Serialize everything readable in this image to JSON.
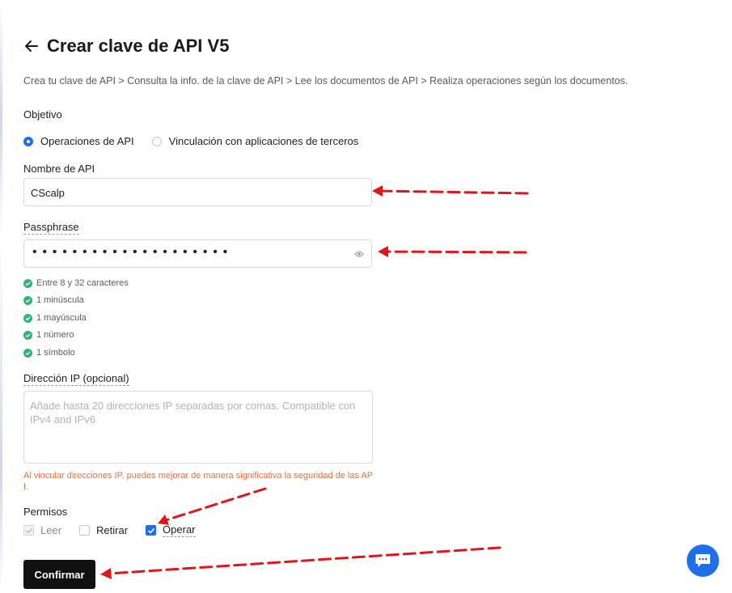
{
  "header": {
    "title": "Crear clave de API V5",
    "back_icon": "arrow-left-icon"
  },
  "breadcrumb": "Crea tu clave de API > Consulta la info. de la clave de API > Lee los documentos de API > Realiza operaciones según los documentos.",
  "objective": {
    "label": "Objetivo",
    "options": [
      {
        "label": "Operaciones de API",
        "selected": true
      },
      {
        "label": "Vinculación con aplicaciones de terceros",
        "selected": false
      }
    ]
  },
  "api_name": {
    "label": "Nombre de API",
    "value": "CScalp"
  },
  "passphrase": {
    "label": "Passphrase",
    "masked_value": "••••••••••••••••••••",
    "visibility_icon": "eye-icon",
    "rules": [
      "Entre 8 y 32 caracteres",
      "1 minúscula",
      "1 mayúscula",
      "1 número",
      "1 símbolo"
    ]
  },
  "ip": {
    "label": "Dirección IP (opcional)",
    "placeholder": "Añade hasta 20 direcciones IP separadas por comas. Compatible con IPv4 and IPv6",
    "warning": "Al vincular direcciones IP, puedes mejorar de manera significativa la seguridad de las API."
  },
  "permissions": {
    "label": "Permisos",
    "items": [
      {
        "label": "Leer",
        "checked": true,
        "disabled": true
      },
      {
        "label": "Retirar",
        "checked": false,
        "disabled": false
      },
      {
        "label": "Operar",
        "checked": true,
        "disabled": false
      }
    ]
  },
  "confirm_label": "Confirmar",
  "chat_icon": "chat-bubble-icon",
  "colors": {
    "accent": "#1f6feb",
    "success": "#2bb673",
    "warning": "#e8703a",
    "annotation": "#e0161b",
    "button": "#111111"
  }
}
